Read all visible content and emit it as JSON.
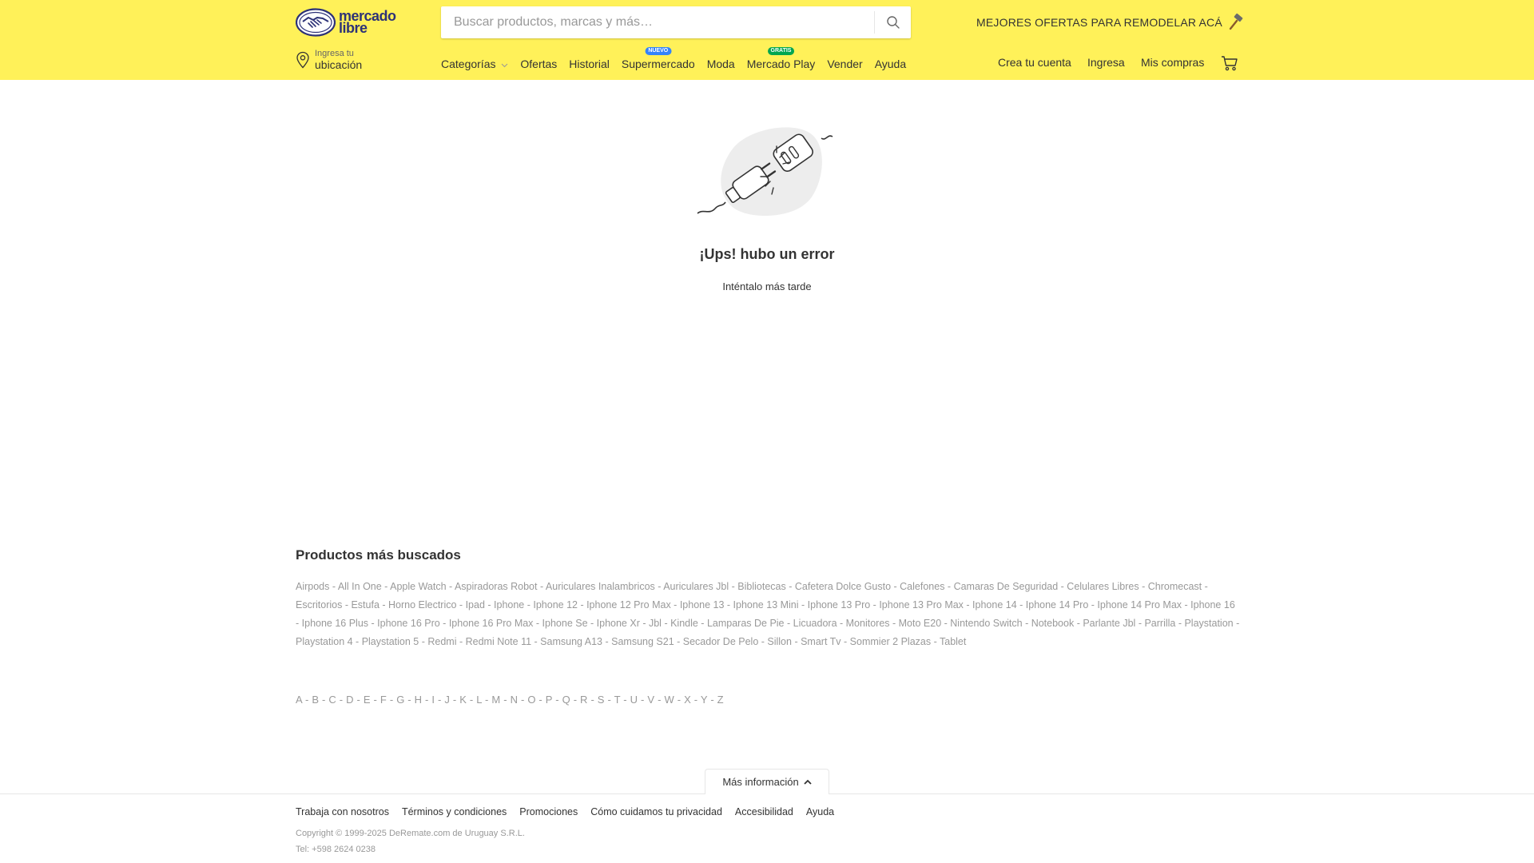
{
  "header": {
    "logo_line1": "mercado",
    "logo_line2": "libre",
    "search_placeholder": "Buscar productos, marcas y más…",
    "promo_text": "MEJORES OFERTAS PARA REMODELAR ACÁ",
    "location_small": "Ingresa tu",
    "location_big": "ubicación",
    "nav": {
      "categorias": "Categorías",
      "ofertas": "Ofertas",
      "historial": "Historial",
      "supermercado": "Supermercado",
      "supermercado_badge": "NUEVO",
      "moda": "Moda",
      "mercado_play": "Mercado Play",
      "mercado_play_badge": "GRATIS",
      "vender": "Vender",
      "ayuda": "Ayuda"
    },
    "account": {
      "crea_cuenta": "Crea tu cuenta",
      "ingresa": "Ingresa",
      "mis_compras": "Mis compras"
    },
    "colors": {
      "header_bg": "#fff159",
      "nuevo_badge": "#3483fa",
      "gratis_badge": "#00a650"
    }
  },
  "error": {
    "title": "¡Ups! hubo un error",
    "subtitle": "Inténtalo más tarde"
  },
  "popular": {
    "title": "Productos más buscados",
    "items": [
      "Airpods",
      "All In One",
      "Apple Watch",
      "Aspiradoras Robot",
      "Auriculares Inalambricos",
      "Auriculares Jbl",
      "Bibliotecas",
      "Cafetera Dolce Gusto",
      "Calefones",
      "Camaras De Seguridad",
      "Celulares Libres",
      "Chromecast",
      "Escritorios",
      "Estufa",
      "Horno Electrico",
      "Ipad",
      "Iphone",
      "Iphone 12",
      "Iphone 12 Pro Max",
      "Iphone 13",
      "Iphone 13 Mini",
      "Iphone 13 Pro",
      "Iphone 13 Pro Max",
      "Iphone 14",
      "Iphone 14 Pro",
      "Iphone 14 Pro Max",
      "Iphone 16",
      "Iphone 16 Plus",
      "Iphone 16 Pro",
      "Iphone 16 Pro Max",
      "Iphone Se",
      "Iphone Xr",
      "Jbl",
      "Kindle",
      "Lamparas De Pie",
      "Licuadora",
      "Monitores",
      "Moto E20",
      "Nintendo Switch",
      "Notebook",
      "Parlante Jbl",
      "Parrilla",
      "Playstation",
      "Playstation 4",
      "Playstation 5",
      "Redmi",
      "Redmi Note 11",
      "Samsung A13",
      "Samsung S21",
      "Secador De Pelo",
      "Sillon",
      "Smart Tv",
      "Sommier 2 Plazas",
      "Tablet"
    ],
    "separator": " - "
  },
  "alphabet": [
    "A",
    "B",
    "C",
    "D",
    "E",
    "F",
    "G",
    "H",
    "I",
    "J",
    "K",
    "L",
    "M",
    "N",
    "O",
    "P",
    "Q",
    "R",
    "S",
    "T",
    "U",
    "V",
    "W",
    "X",
    "Y",
    "Z"
  ],
  "footer": {
    "more_info": "Más información",
    "links": [
      "Trabaja con nosotros",
      "Términos y condiciones",
      "Promociones",
      "Cómo cuidamos tu privacidad",
      "Accesibilidad",
      "Ayuda"
    ],
    "copyright": "Copyright © 1999-2025 DeRemate.com de Uruguay S.R.L.",
    "phone": "Tel: +598 2624 0238"
  }
}
